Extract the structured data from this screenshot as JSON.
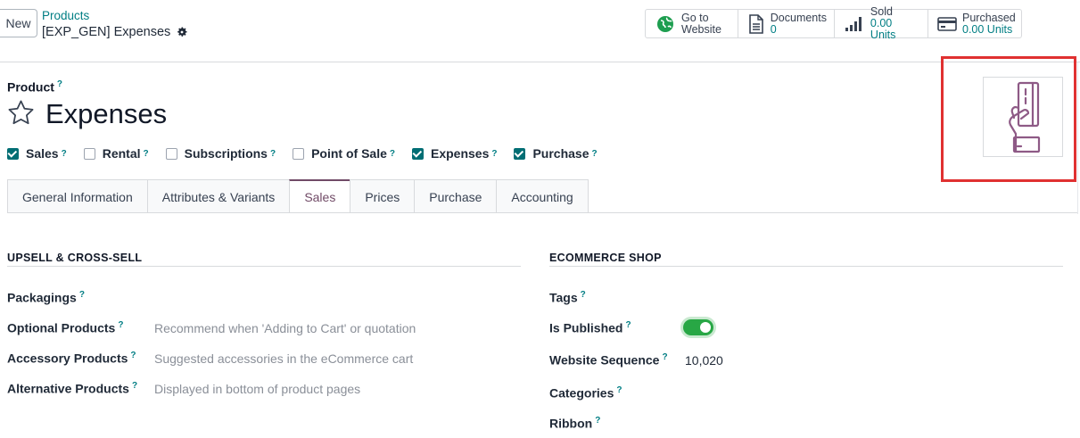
{
  "control_panel": {
    "new_button": "New",
    "breadcrumb_parent": "Products",
    "breadcrumb_current": "[EXP_GEN] Expenses",
    "stat_buttons": {
      "website": {
        "label": "Go to",
        "value": "Website",
        "icon": "globe-icon"
      },
      "documents": {
        "label": "Documents",
        "value": "0",
        "icon": "document-icon"
      },
      "sold": {
        "label": "Sold",
        "value": "0.00 Units",
        "icon": "signal-bars-icon"
      },
      "purchased": {
        "label": "Purchased",
        "value": "0.00 Units",
        "icon": "credit-card-icon"
      }
    }
  },
  "form": {
    "product_label": "Product",
    "help_mark": "?",
    "product_name": "Expenses",
    "options": [
      {
        "label": "Sales",
        "checked": true
      },
      {
        "label": "Rental",
        "checked": false
      },
      {
        "label": "Subscriptions",
        "checked": false
      },
      {
        "label": "Point of Sale",
        "checked": false
      },
      {
        "label": "Expenses",
        "checked": true
      },
      {
        "label": "Purchase",
        "checked": true
      }
    ],
    "tabs": [
      "General Information",
      "Attributes & Variants",
      "Sales",
      "Prices",
      "Purchase",
      "Accounting"
    ],
    "active_tab": "Sales"
  },
  "upsell": {
    "title": "UPSELL & CROSS-SELL",
    "packagings": "Packagings",
    "optional_products": "Optional Products",
    "optional_products_placeholder": "Recommend when 'Adding to Cart' or quotation",
    "accessory_products": "Accessory Products",
    "accessory_products_placeholder": "Suggested accessories in the eCommerce cart",
    "alternative_products": "Alternative Products",
    "alternative_products_placeholder": "Displayed in bottom of product pages"
  },
  "ecommerce": {
    "title": "ECOMMERCE SHOP",
    "tags": "Tags",
    "is_published": "Is Published",
    "is_published_value": true,
    "website_sequence": "Website Sequence",
    "website_sequence_value": "10,020",
    "categories": "Categories",
    "ribbon": "Ribbon"
  },
  "colors": {
    "accent": "#714b67",
    "link": "#017e84",
    "checkbox": "#016e74",
    "highlight": "#e03131",
    "toggle_on": "#28a745"
  }
}
